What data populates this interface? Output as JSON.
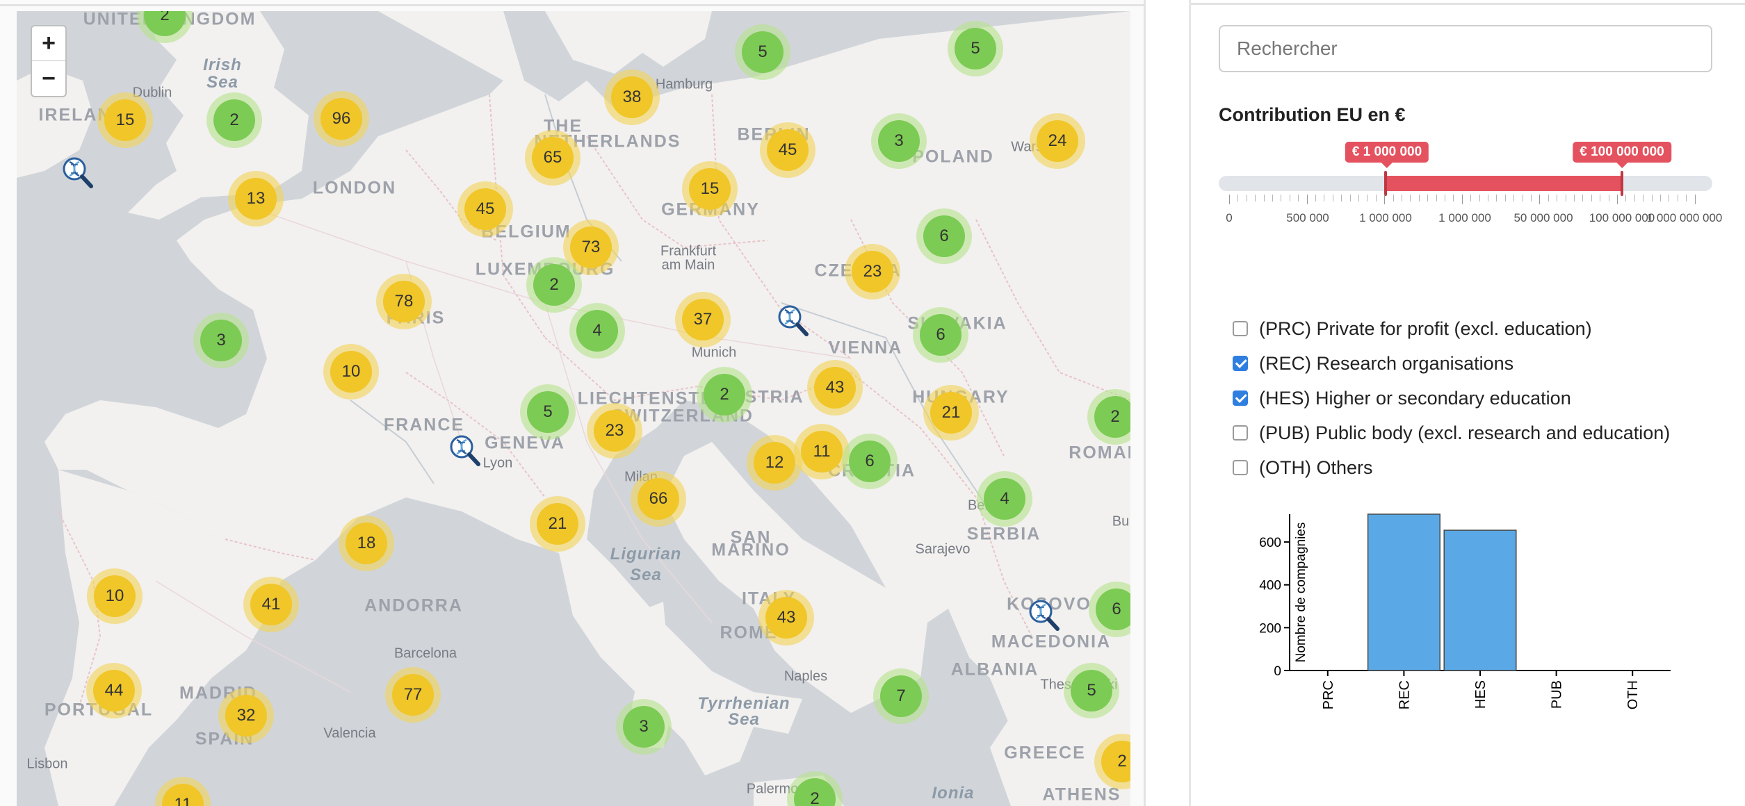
{
  "map": {
    "zoom_in": "+",
    "zoom_out": "−",
    "colors": {
      "yellow_cluster": "#f0c629",
      "green_cluster": "#7ccb54",
      "water": "#d1d5d9",
      "land": "#f2f1ef"
    },
    "places": [
      {
        "text": "UNITED KINGDOM",
        "kind": "country"
      },
      {
        "text": "Irish",
        "kind": "sea"
      },
      {
        "text": "Sea",
        "kind": "sea"
      },
      {
        "text": "Dublin",
        "kind": "city"
      },
      {
        "text": "IRELAND",
        "kind": "country"
      },
      {
        "text": "LONDON",
        "kind": "country"
      },
      {
        "text": "Hamburg",
        "kind": "city"
      },
      {
        "text": "THE",
        "kind": "country"
      },
      {
        "text": "NETHERLANDS",
        "kind": "country"
      },
      {
        "text": "BERLIN",
        "kind": "country"
      },
      {
        "text": "POLAND",
        "kind": "country"
      },
      {
        "text": "Warsaw",
        "kind": "city"
      },
      {
        "text": "GERMANY",
        "kind": "country"
      },
      {
        "text": "BELGIUM",
        "kind": "country"
      },
      {
        "text": "LUXEMBOURG",
        "kind": "country"
      },
      {
        "text": "Frankfurt",
        "kind": "city"
      },
      {
        "text": "am Main",
        "kind": "city"
      },
      {
        "text": "CZECHIA",
        "kind": "country"
      },
      {
        "text": "PARIS",
        "kind": "country"
      },
      {
        "text": "SLOVAKIA",
        "kind": "country"
      },
      {
        "text": "VIENNA",
        "kind": "country"
      },
      {
        "text": "Munich",
        "kind": "city"
      },
      {
        "text": "HUNGARY",
        "kind": "country"
      },
      {
        "text": "FRANCE",
        "kind": "country"
      },
      {
        "text": "LIECHTENSTEIN",
        "kind": "country"
      },
      {
        "text": "AUSTRIA",
        "kind": "country"
      },
      {
        "text": "SWITZERLAND",
        "kind": "country"
      },
      {
        "text": "GENEVA",
        "kind": "country"
      },
      {
        "text": "Lyon",
        "kind": "city"
      },
      {
        "text": "Milan",
        "kind": "city"
      },
      {
        "text": "CROATIA",
        "kind": "country"
      },
      {
        "text": "ROMANIA",
        "kind": "country"
      },
      {
        "text": "Belgrade",
        "kind": "city"
      },
      {
        "text": "SERBIA",
        "kind": "country"
      },
      {
        "text": "Ligurian",
        "kind": "sea"
      },
      {
        "text": "Sea",
        "kind": "sea"
      },
      {
        "text": "SAN",
        "kind": "country"
      },
      {
        "text": "MARINO",
        "kind": "country"
      },
      {
        "text": "Sarajevo",
        "kind": "city"
      },
      {
        "text": "ANDORRA",
        "kind": "country"
      },
      {
        "text": "ITALY",
        "kind": "country"
      },
      {
        "text": "KOSOVO",
        "kind": "country"
      },
      {
        "text": "MACEDONIA",
        "kind": "country"
      },
      {
        "text": "Barcelona",
        "kind": "city"
      },
      {
        "text": "ROME",
        "kind": "country"
      },
      {
        "text": "ALBANIA",
        "kind": "country"
      },
      {
        "text": "Thessaloniki",
        "kind": "city"
      },
      {
        "text": "MADRID",
        "kind": "country"
      },
      {
        "text": "PORTUGAL",
        "kind": "country"
      },
      {
        "text": "SPAIN",
        "kind": "country"
      },
      {
        "text": "Valencia",
        "kind": "city"
      },
      {
        "text": "Naples",
        "kind": "city"
      },
      {
        "text": "Tyrrhenian",
        "kind": "sea"
      },
      {
        "text": "Sea",
        "kind": "sea"
      },
      {
        "text": "GREECE",
        "kind": "country"
      },
      {
        "text": "Lisbon",
        "kind": "city"
      },
      {
        "text": "Palermo",
        "kind": "city"
      },
      {
        "text": "Ionia",
        "kind": "sea"
      },
      {
        "text": "ATHENS",
        "kind": "country"
      },
      {
        "text": "Bu",
        "kind": "city"
      }
    ],
    "clusters": [
      {
        "n": "2",
        "color": "green"
      },
      {
        "n": "15",
        "color": "yellow"
      },
      {
        "n": "2",
        "color": "green"
      },
      {
        "n": "96",
        "color": "yellow"
      },
      {
        "n": "38",
        "color": "yellow"
      },
      {
        "n": "5",
        "color": "green"
      },
      {
        "n": "5",
        "color": "green"
      },
      {
        "n": "65",
        "color": "yellow"
      },
      {
        "n": "45",
        "color": "yellow"
      },
      {
        "n": "3",
        "color": "green"
      },
      {
        "n": "24",
        "color": "yellow"
      },
      {
        "n": "13",
        "color": "yellow"
      },
      {
        "n": "15",
        "color": "yellow"
      },
      {
        "n": "45",
        "color": "yellow"
      },
      {
        "n": "73",
        "color": "yellow"
      },
      {
        "n": "6",
        "color": "green"
      },
      {
        "n": "2",
        "color": "green"
      },
      {
        "n": "23",
        "color": "yellow"
      },
      {
        "n": "78",
        "color": "yellow"
      },
      {
        "n": "4",
        "color": "green"
      },
      {
        "n": "37",
        "color": "yellow"
      },
      {
        "n": "6",
        "color": "green"
      },
      {
        "n": "3",
        "color": "green"
      },
      {
        "n": "10",
        "color": "yellow"
      },
      {
        "n": "43",
        "color": "yellow"
      },
      {
        "n": "2",
        "color": "green"
      },
      {
        "n": "21",
        "color": "yellow"
      },
      {
        "n": "5",
        "color": "green"
      },
      {
        "n": "23",
        "color": "yellow"
      },
      {
        "n": "2",
        "color": "green"
      },
      {
        "n": "11",
        "color": "yellow"
      },
      {
        "n": "12",
        "color": "yellow"
      },
      {
        "n": "6",
        "color": "green"
      },
      {
        "n": "66",
        "color": "yellow"
      },
      {
        "n": "4",
        "color": "green"
      },
      {
        "n": "21",
        "color": "yellow"
      },
      {
        "n": "18",
        "color": "yellow"
      },
      {
        "n": "10",
        "color": "yellow"
      },
      {
        "n": "41",
        "color": "yellow"
      },
      {
        "n": "43",
        "color": "yellow"
      },
      {
        "n": "6",
        "color": "green"
      },
      {
        "n": "44",
        "color": "yellow"
      },
      {
        "n": "77",
        "color": "yellow"
      },
      {
        "n": "7",
        "color": "green"
      },
      {
        "n": "5",
        "color": "green"
      },
      {
        "n": "32",
        "color": "yellow"
      },
      {
        "n": "3",
        "color": "green"
      },
      {
        "n": "2",
        "color": "yellow"
      },
      {
        "n": "2",
        "color": "green"
      },
      {
        "n": "11",
        "color": "yellow"
      }
    ],
    "markers": [
      {
        "icon": "dna-search-icon"
      },
      {
        "icon": "dna-search-icon"
      },
      {
        "icon": "dna-search-icon"
      },
      {
        "icon": "dna-search-icon"
      }
    ]
  },
  "sidebar": {
    "search_placeholder": "Rechercher",
    "contribution_title": "Contribution EU en €",
    "slider": {
      "min_label": "€ 1 000 000",
      "max_label": "€ 100 000 000",
      "tick_labels": [
        "0",
        "500 000",
        "1 000 000",
        "1 000 000",
        "50 000 000",
        "100 000 000",
        "1 000 000 000"
      ],
      "accent": "#e5525f"
    },
    "filters": [
      {
        "label": "(PRC) Private for profit (excl. education)",
        "checked": false
      },
      {
        "label": "(REC) Research organisations",
        "checked": true
      },
      {
        "label": "(HES) Higher or secondary education",
        "checked": true
      },
      {
        "label": "(PUB) Public body (excl. research and education)",
        "checked": false
      },
      {
        "label": "(OTH) Others",
        "checked": false
      }
    ]
  },
  "chart_data": {
    "type": "bar",
    "categories": [
      "PRC",
      "REC",
      "HES",
      "PUB",
      "OTH"
    ],
    "values": [
      0,
      730,
      655,
      0,
      0
    ],
    "ylabel": "Nombre de compagnies",
    "xlabel": "",
    "ylim": [
      0,
      730
    ],
    "yticks": [
      0,
      200,
      400,
      600
    ],
    "bar_color": "#5aa9e6"
  }
}
